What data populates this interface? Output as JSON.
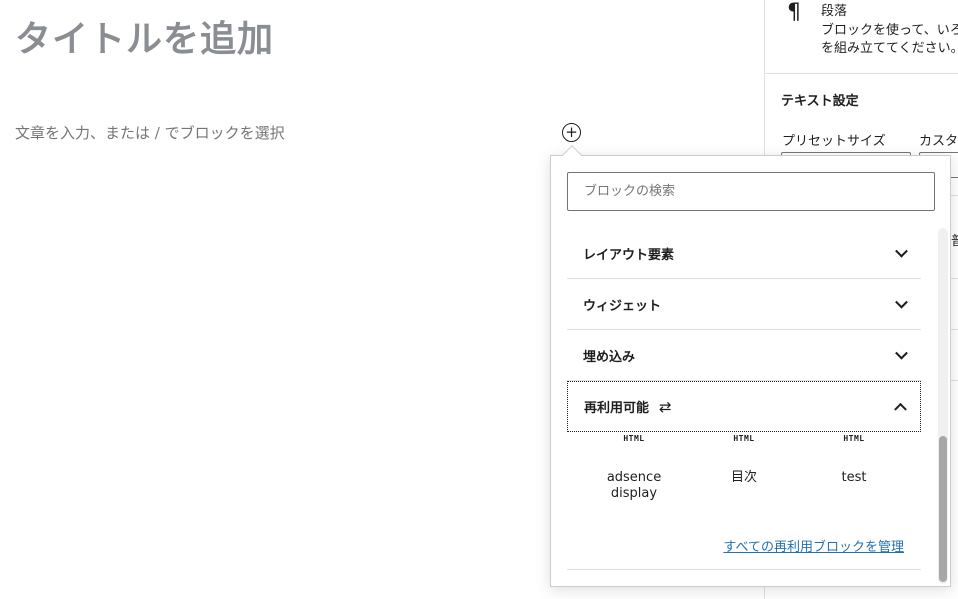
{
  "editor": {
    "title_placeholder": "タイトルを追加",
    "paragraph_placeholder": "文章を入力、または / でブロックを選択",
    "inserter_toggle_glyph": "+"
  },
  "sidebar": {
    "block_name": "段落",
    "block_desc_line1": "ブロックを使って、いろ",
    "block_desc_line2": "を組み立ててください。",
    "text_settings_title": "テキスト設定",
    "preset_size_label": "プリセットサイズ",
    "custom_label": "カスタ",
    "fragment": "普"
  },
  "inserter": {
    "search_placeholder": "ブロックの検索",
    "categories": [
      {
        "label": "レイアウト要素",
        "state": "collapsed"
      },
      {
        "label": "ウィジェット",
        "state": "collapsed"
      },
      {
        "label": "埋め込み",
        "state": "collapsed"
      },
      {
        "label": "再利用可能",
        "state": "expanded",
        "icon": "reusable-block-icon"
      }
    ],
    "reusable_blocks": [
      {
        "icon_text": "HTML",
        "label": "adsence display"
      },
      {
        "icon_text": "HTML",
        "label": "目次"
      },
      {
        "icon_text": "HTML",
        "label": "test"
      }
    ],
    "manage_link": "すべての再利用ブロックを管理"
  },
  "colors": {
    "link": "#2271b1",
    "title_placeholder": "#8a8d92",
    "border": "#e0e0e0"
  }
}
